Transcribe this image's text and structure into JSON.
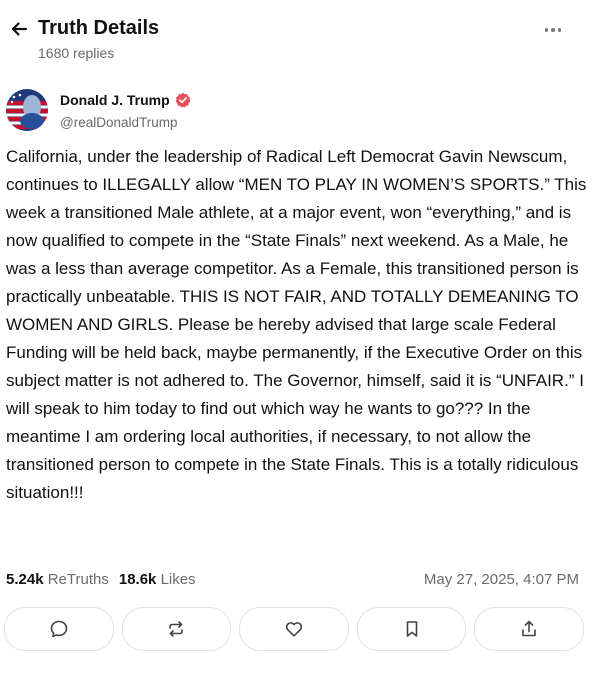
{
  "header": {
    "title": "Truth Details",
    "replies": "1680 replies",
    "back_icon": "arrow-left-icon",
    "more_icon": "more-horizontal-icon"
  },
  "post": {
    "author": {
      "name": "Donald J. Trump",
      "handle": "@realDonaldTrump",
      "verified": true,
      "verified_color": "#e84d5b"
    },
    "text": "California, under the leadership of Radical Left Democrat Gavin Newscum, continues to ILLEGALLY allow “MEN TO PLAY IN WOMEN’S SPORTS.” This week a transitioned Male athlete, at a major event, won “everything,” and is now qualified to compete in the “State Finals” next weekend. As a Male, he was a less than average competitor. As a Female, this transitioned person is practically unbeatable. THIS IS NOT FAIR, AND TOTALLY DEMEANING TO WOMEN AND GIRLS. Please be hereby advised that large scale Federal Funding will be held back, maybe permanently, if the Executive Order on this subject matter is not adhered to. The Governor, himself, said it is “UNFAIR.” I will speak to him today to find out which way he wants to go??? In the meantime I am ordering local authorities, if necessary, to not allow the transitioned person to compete in the State Finals. This is a totally ridiculous situation!!!",
    "retruths_count": "5.24k",
    "retruths_label": "ReTruths",
    "likes_count": "18.6k",
    "likes_label": "Likes",
    "timestamp": "May 27, 2025, 4:07 PM"
  },
  "actions": [
    {
      "name": "reply",
      "icon": "comment-icon"
    },
    {
      "name": "retruth",
      "icon": "repost-icon"
    },
    {
      "name": "like",
      "icon": "heart-icon"
    },
    {
      "name": "bookmark",
      "icon": "bookmark-icon"
    },
    {
      "name": "share",
      "icon": "share-icon"
    }
  ]
}
